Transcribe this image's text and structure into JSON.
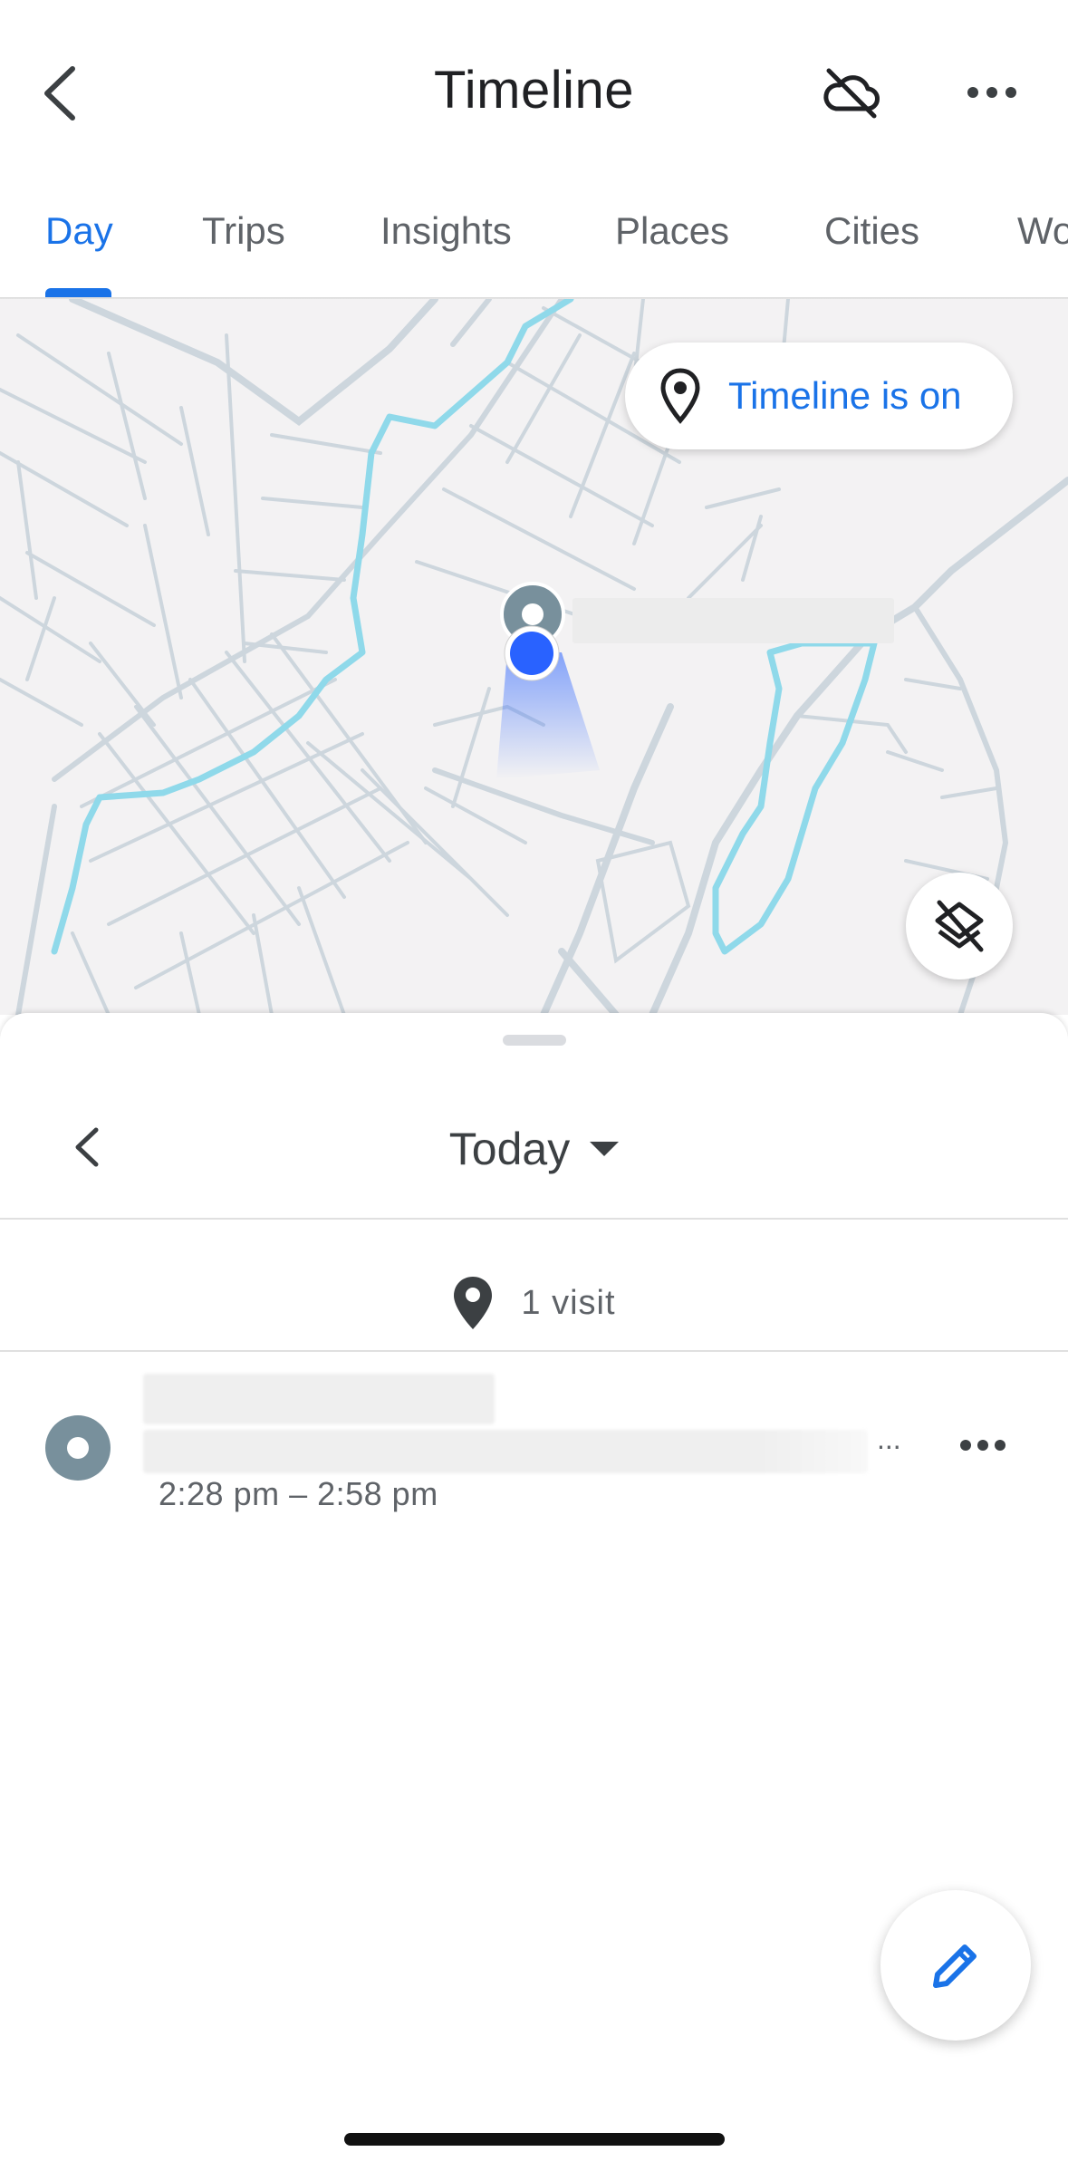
{
  "header": {
    "title": "Timeline",
    "back_icon": "chevron-left-icon",
    "cloud_icon": "cloud-off-icon",
    "more_icon": "more-horizontal-icon"
  },
  "tabs": [
    {
      "label": "Day",
      "active": true
    },
    {
      "label": "Trips",
      "active": false
    },
    {
      "label": "Insights",
      "active": false
    },
    {
      "label": "Places",
      "active": false
    },
    {
      "label": "Cities",
      "active": false
    },
    {
      "label": "Wo",
      "active": false
    }
  ],
  "map": {
    "status_label": "Timeline is on",
    "status_icon": "map-pin-icon",
    "layers_icon": "layers-off-icon"
  },
  "day": {
    "label": "Today",
    "prev_icon": "chevron-left-icon"
  },
  "summary": {
    "label": "1 visit",
    "icon": "place-marker-icon"
  },
  "visits": [
    {
      "time": "2:28 pm – 2:58 pm",
      "ellipsis": "..."
    }
  ],
  "fab": {
    "icon": "edit-pencil-icon"
  },
  "colors": {
    "accent": "#1a73e8",
    "route": "#8fd9ea",
    "road": "#cdd6dd",
    "map_bg": "#f3f2f3",
    "visit_marker": "#78909c",
    "location_dot": "#2962ff"
  }
}
